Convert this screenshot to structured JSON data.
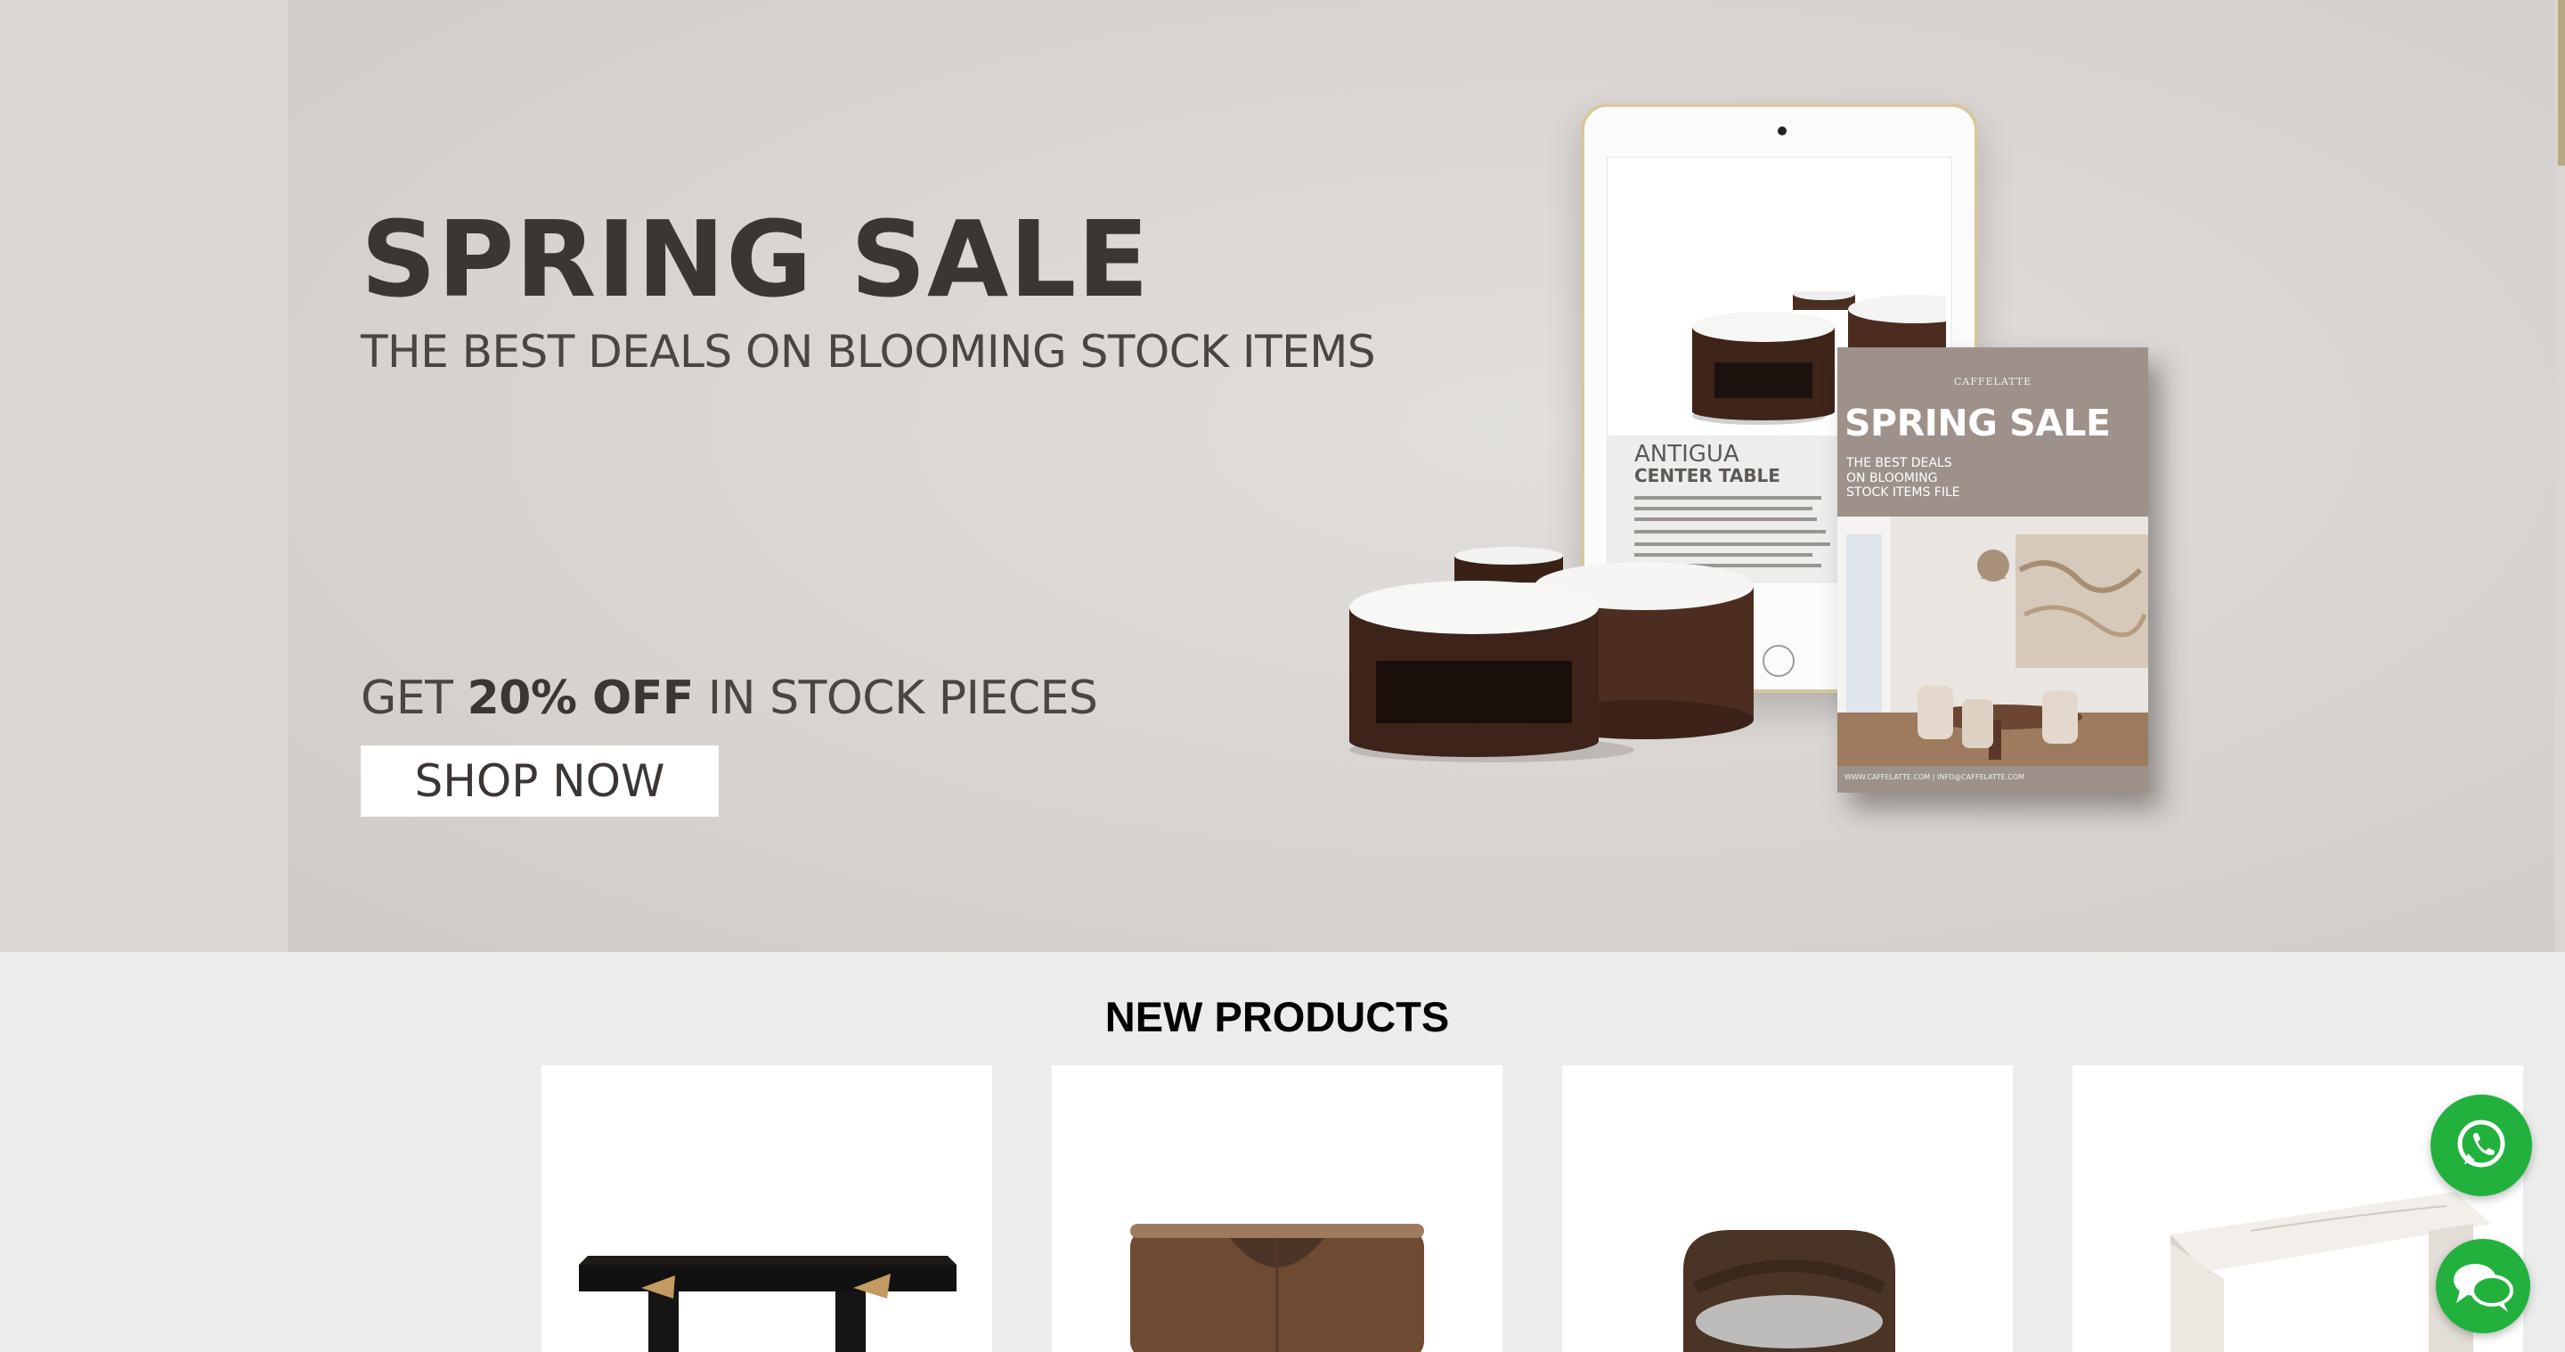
{
  "hero": {
    "title": "SPRING SALE",
    "subtitle": "THE BEST DEALS ON BLOOMING STOCK ITEMS",
    "offer_prefix": "GET ",
    "offer_bold": "20% OFF",
    "offer_suffix": " IN STOCK PIECES",
    "cta_label": "SHOP NOW",
    "tablet": {
      "product_name": "ANTIGUA",
      "product_type": "CENTER TABLE"
    },
    "brochure": {
      "brand": "CAFFELATTE",
      "title": "SPRING SALE",
      "subtitle_lines": [
        "THE BEST DEALS",
        "ON BLOOMING",
        "STOCK ITEMS FILE"
      ],
      "footer": "WWW.CAFFELATTE.COM | INFO@CAFFELATTE.COM"
    }
  },
  "new_products": {
    "heading": "NEW PRODUCTS"
  },
  "floating": {
    "whatsapp_icon": "whatsapp-icon",
    "chat_icon": "chat-bubbles-icon"
  },
  "colors": {
    "hero_bg": "#d9d6d3",
    "headline": "#3b3634",
    "accent_gold": "#b8a883",
    "whatsapp_green": "#22b13c",
    "page_bg": "#ececec"
  }
}
